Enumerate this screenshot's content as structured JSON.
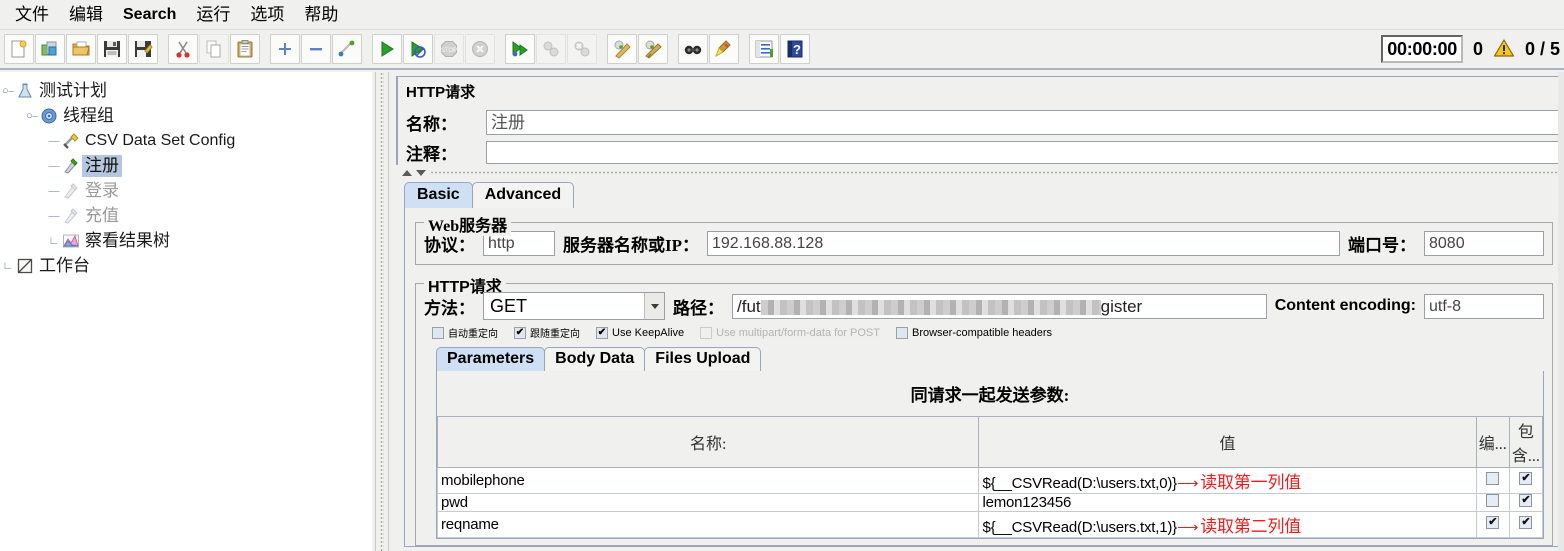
{
  "menu": {
    "items": [
      {
        "label": "文件",
        "latin": false
      },
      {
        "label": "编辑",
        "latin": false
      },
      {
        "label": "Search",
        "latin": true
      },
      {
        "label": "运行",
        "latin": false
      },
      {
        "label": "选项",
        "latin": false
      },
      {
        "label": "帮助",
        "latin": false
      }
    ]
  },
  "toolbar": {
    "buttons": [
      {
        "name": "new-icon"
      },
      {
        "name": "templates-icon"
      },
      {
        "name": "open-icon"
      },
      {
        "name": "save-icon"
      },
      {
        "name": "save-as-icon"
      },
      {
        "name": "cut-icon"
      },
      {
        "name": "copy-icon"
      },
      {
        "name": "paste-icon"
      },
      {
        "name": "expand-icon"
      },
      {
        "name": "collapse-icon"
      },
      {
        "name": "toggle-icon"
      },
      {
        "name": "start-icon"
      },
      {
        "name": "start-no-pause-icon"
      },
      {
        "name": "stop-icon"
      },
      {
        "name": "shutdown-icon"
      },
      {
        "name": "remote-start-all-icon"
      },
      {
        "name": "remote-stop-all-icon"
      },
      {
        "name": "remote-shutdown-all-icon"
      },
      {
        "name": "clear-icon"
      },
      {
        "name": "clear-all-icon"
      },
      {
        "name": "search-icon"
      },
      {
        "name": "search-reset-icon"
      },
      {
        "name": "function-helper-icon"
      },
      {
        "name": "help-icon"
      }
    ],
    "timer": "00:00:00",
    "warning_count": "0",
    "warning_icon": "warning-triangle-icon",
    "thread_count": "0 / 5"
  },
  "tree": {
    "nodes": [
      {
        "label": "测试计划",
        "icon": "test-plan-icon",
        "depth": 0,
        "state": "normal",
        "latin": false,
        "toggle": "open"
      },
      {
        "label": "线程组",
        "icon": "thread-group-icon",
        "depth": 1,
        "state": "normal",
        "latin": false,
        "toggle": "open"
      },
      {
        "label": "CSV Data Set Config",
        "icon": "config-icon",
        "depth": 2,
        "state": "normal",
        "latin": true,
        "toggle": "none"
      },
      {
        "label": "注册",
        "icon": "sampler-icon",
        "depth": 2,
        "state": "selected",
        "latin": false,
        "toggle": "none"
      },
      {
        "label": "登录",
        "icon": "sampler-off-icon",
        "depth": 2,
        "state": "disabled",
        "latin": false,
        "toggle": "none"
      },
      {
        "label": "充值",
        "icon": "sampler-off-icon",
        "depth": 2,
        "state": "disabled",
        "latin": false,
        "toggle": "none"
      },
      {
        "label": "察看结果树",
        "icon": "view-results-icon",
        "depth": 2,
        "state": "normal",
        "latin": false,
        "toggle": "last"
      },
      {
        "label": "工作台",
        "icon": "workbench-icon",
        "depth": 0,
        "state": "normal",
        "latin": false,
        "toggle": "last"
      }
    ]
  },
  "panel": {
    "title": "HTTP请求",
    "name_label": "名称：",
    "name_value": "注册",
    "comment_label": "注释：",
    "comment_value": "",
    "tabs": [
      {
        "label": "Basic",
        "active": true
      },
      {
        "label": "Advanced",
        "active": false
      }
    ],
    "web_server": {
      "legend": "Web服务器",
      "protocol_label": "协议：",
      "protocol_value": "http",
      "server_label": "服务器名称或IP：",
      "server_value": "192.168.88.128",
      "port_label": "端口号：",
      "port_value": "8080"
    },
    "http_request": {
      "legend": "HTTP请求",
      "method_label": "方法：",
      "method_value": "GET",
      "path_label": "路径：",
      "path_prefix": "/fut",
      "path_suffix": "gister",
      "path_redacted": true,
      "encoding_label": "Content encoding:",
      "encoding_value": "utf-8",
      "checkboxes": [
        {
          "label": "自动重定向",
          "checked": false,
          "disabled": false,
          "cjk": true
        },
        {
          "label": "跟随重定向",
          "checked": true,
          "disabled": false,
          "cjk": true
        },
        {
          "label": "Use KeepAlive",
          "checked": true,
          "disabled": false,
          "cjk": false
        },
        {
          "label": "Use multipart/form-data for POST",
          "checked": false,
          "disabled": true,
          "cjk": false
        },
        {
          "label": "Browser-compatible headers",
          "checked": false,
          "disabled": false,
          "cjk": false
        }
      ]
    },
    "param_tabs": [
      {
        "label": "Parameters",
        "active": true
      },
      {
        "label": "Body Data",
        "active": false
      },
      {
        "label": "Files Upload",
        "active": false
      }
    ],
    "params_table": {
      "caption": "同请求一起发送参数:",
      "columns": [
        "名称:",
        "值",
        "编...",
        "包含..."
      ],
      "rows": [
        {
          "name": "mobilephone",
          "value": "${__CSVRead(D:\\users.txt,0)}",
          "annotation": "读取第一列值",
          "encode": false,
          "include": true
        },
        {
          "name": "pwd",
          "value": "lemon123456",
          "annotation": "",
          "encode": false,
          "include": true
        },
        {
          "name": "reqname",
          "value": "${__CSVRead(D:\\users.txt,1)}",
          "annotation": "读取第二列值",
          "encode": true,
          "include": true
        }
      ]
    }
  },
  "colors": {
    "selection": "#b5c7de",
    "tab_active": "#cfe0f5",
    "annotation_red": "#ee1c1c",
    "panel_bg": "#f0f0ee"
  }
}
